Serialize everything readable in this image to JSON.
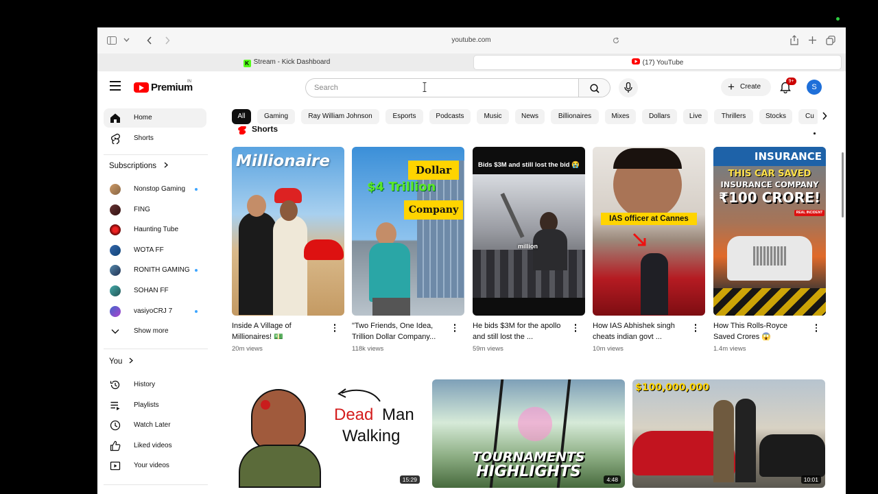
{
  "browser": {
    "url": "youtube.com",
    "tabs": [
      {
        "label": "Stream - Kick Dashboard",
        "favicon": "K"
      },
      {
        "label": "(17) YouTube",
        "favicon": "youtube-play"
      }
    ]
  },
  "header": {
    "logo_text": "Premium",
    "region": "IN",
    "search_placeholder": "Search",
    "create_label": "Create",
    "notifications_badge": "9+",
    "avatar_letter": "S"
  },
  "sidebar": {
    "main": [
      {
        "label": "Home",
        "icon": "home-icon"
      },
      {
        "label": "Shorts",
        "icon": "shorts-icon"
      }
    ],
    "subscriptions_heading": "Subscriptions",
    "subscriptions": [
      {
        "label": "Nonstop Gaming",
        "new": true
      },
      {
        "label": "FING",
        "new": false
      },
      {
        "label": "Haunting Tube",
        "new": false
      },
      {
        "label": "WOTA FF",
        "new": false
      },
      {
        "label": "RONITH GAMING",
        "new": true
      },
      {
        "label": "SOHAN FF",
        "new": false
      },
      {
        "label": "vasiyoCRJ 7",
        "new": true
      }
    ],
    "show_more": "Show more",
    "you_heading": "You",
    "you": [
      {
        "label": "History",
        "icon": "history-icon"
      },
      {
        "label": "Playlists",
        "icon": "playlists-icon"
      },
      {
        "label": "Watch Later",
        "icon": "clock-icon"
      },
      {
        "label": "Liked videos",
        "icon": "thumbs-up-icon"
      },
      {
        "label": "Your videos",
        "icon": "video-icon"
      }
    ]
  },
  "chips": [
    "All",
    "Gaming",
    "Ray William Johnson",
    "Esports",
    "Podcasts",
    "Music",
    "News",
    "Billionaires",
    "Mixes",
    "Dollars",
    "Live",
    "Thrillers",
    "Stocks",
    "Cu"
  ],
  "shorts_heading": "Shorts",
  "shorts": [
    {
      "title": "Inside A Village of Millionaires! 💵",
      "views": "20m views",
      "thumb_text": "Millionaire"
    },
    {
      "title": "\"Two Friends, One Idea, Trillion Dollar Company...",
      "views": "118k views",
      "thumb_text": [
        "Dollar",
        "$4 Trillion",
        "Company"
      ]
    },
    {
      "title": "He bids $3M for the apollo and still lost the ...",
      "views": "59m views",
      "thumb_text": [
        "Bids $3M and still lost the bid 😭",
        "million"
      ]
    },
    {
      "title": "How IAS Abhishek singh cheats indian govt ...",
      "views": "10m views",
      "thumb_text": "IAS officer at Cannes"
    },
    {
      "title": "How This Rolls-Royce Saved Crores 😱",
      "views": "1.4m views",
      "thumb_text": [
        "INSURANCE",
        "THIS CAR SAVED",
        "INSURANCE COMPANY",
        "₹100 CRORE!",
        "REAL INCIDENT"
      ]
    }
  ],
  "videos": [
    {
      "duration": "15:29",
      "thumb_text": [
        "Dead",
        "Man",
        "Walking"
      ]
    },
    {
      "duration": "4:48",
      "thumb_text": [
        "TOURNAMENTS",
        "HIGHLIGHTS"
      ]
    },
    {
      "duration": "10:01",
      "thumb_text": "$100,000,000"
    }
  ]
}
